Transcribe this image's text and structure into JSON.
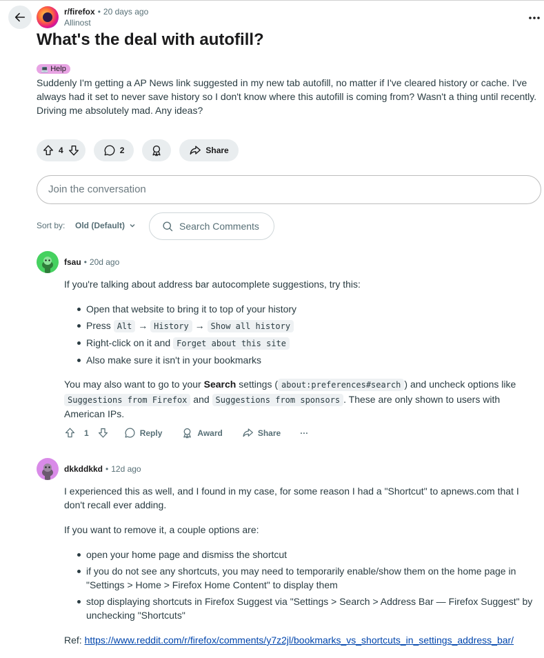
{
  "post": {
    "subreddit": "r/firefox",
    "time": "20 days ago",
    "author": "Allinost",
    "title": "What's the deal with autofill?",
    "flair_icon": "💻",
    "flair": "Help",
    "body": "Suddenly I'm getting a AP News link suggested in my new tab autofill, no matter if I've cleared history or cache. I've always had it set to never save history so I don't know where this autofill is coming from? Wasn't a thing until recently. Driving me absolutely mad. Any ideas?",
    "votes": "4",
    "comments": "2",
    "share_label": "Share"
  },
  "join_placeholder": "Join the conversation",
  "sort": {
    "label": "Sort by:",
    "value": "Old (Default)"
  },
  "search_comments": "Search Comments",
  "separator": "•",
  "comments": [
    {
      "user": "fsau",
      "time": "20d ago",
      "intro": "If you're talking about address bar autocomplete suggestions, try this:",
      "items": {
        "i1": "Open that website to bring it to top of your history",
        "i2_a": "Press",
        "i2_code1": "Alt",
        "arrow": "→",
        "i2_code2": "History",
        "i2_code3": "Show all history",
        "i3_a": "Right-click on it and",
        "i3_code": "Forget about this site",
        "i4": "Also make sure it isn't in your bookmarks"
      },
      "p2": {
        "a": "You may also want to go to your",
        "bold": "Search",
        "b": "settings (",
        "code1": "about:preferences#search",
        "c": ") and uncheck options like",
        "code2": "Suggestions from Firefox",
        "d": "and",
        "code3": "Suggestions from sponsors",
        "e": ". These are only shown to users with American IPs."
      },
      "votes": "1",
      "reply": "Reply",
      "award": "Award",
      "share": "Share",
      "more": "···"
    },
    {
      "user": "dkkddkkd",
      "time": "12d ago",
      "p1": "I experienced this as well, and I found in my case, for some reason I had a \"Shortcut\" to apnews.com that I don't recall ever adding.",
      "p2": "If you want to remove it, a couple options are:",
      "items": [
        "open your home page and dismiss the shortcut",
        "if you do not see any shortcuts, you may need to temporarily enable/show them on the home page in \"Settings > Home > Firefox Home Content\" to display them",
        "stop displaying shortcuts in Firefox Suggest via \"Settings > Search > Address Bar — Firefox Suggest\" by unchecking \"Shortcuts\""
      ],
      "ref_label": "Ref:",
      "ref_link": "https://www.reddit.com/r/firefox/comments/y7z2jl/bookmarks_vs_shortcuts_in_settings_address_bar/"
    }
  ],
  "colors": {
    "accent": "#0045ac",
    "pill_bg": "#e9edef",
    "flair_bg": "#e8a4e4",
    "avatar_green": "#46d160",
    "avatar_purple": "#d98be8"
  }
}
